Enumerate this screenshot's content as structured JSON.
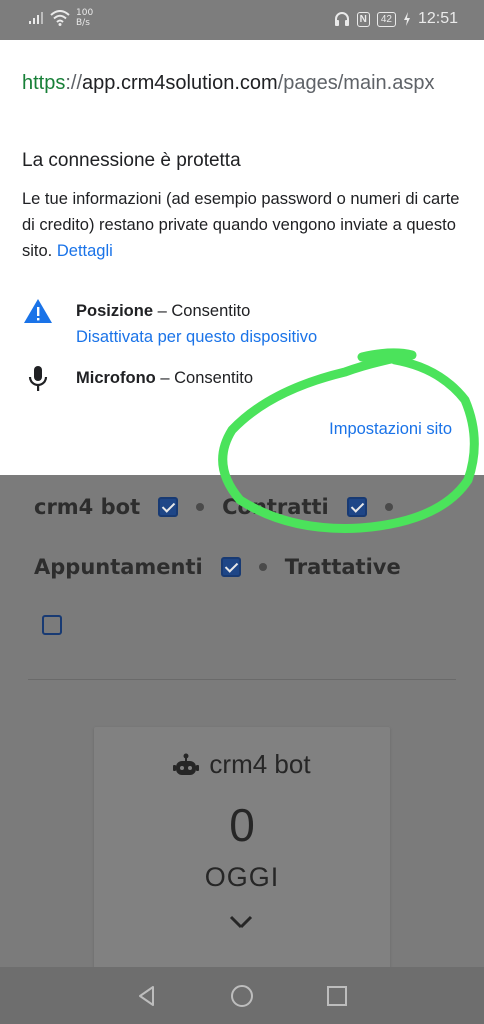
{
  "status_bar": {
    "net_speed_value": "100",
    "net_speed_unit": "B/s",
    "battery": "42",
    "nfc": "N",
    "time": "12:51"
  },
  "popup": {
    "url": {
      "scheme": "https",
      "separator": "://",
      "host": "app.crm4solution.com",
      "path": "/pages/main.aspx"
    },
    "connection_title": "La connessione è protetta",
    "connection_desc": "Le tue informazioni (ad esempio password o numeri di carte di credito) restano private quando vengono inviate a questo sito.",
    "details_link": "Dettagli",
    "permissions": [
      {
        "name": "Posizione",
        "status": "Consentito",
        "sub": "Disattivata per questo dispositivo",
        "icon": "warning-triangle-icon"
      },
      {
        "name": "Microfono",
        "status": "Consentito",
        "icon": "microphone-icon"
      }
    ],
    "dash": "–",
    "site_settings": "Impostazioni sito"
  },
  "page": {
    "filters": [
      {
        "label": "crm4 bot",
        "checked": true
      },
      {
        "label": "Contratti",
        "checked": true
      },
      {
        "label": "Appuntamenti",
        "checked": true
      },
      {
        "label": "Trattative",
        "checked": false
      }
    ],
    "card": {
      "title": "crm4 bot",
      "count": "0",
      "period": "OGGI"
    }
  },
  "colors": {
    "link": "#1a73e8",
    "secure": "#188038",
    "annotation": "#4be35b",
    "checkbox": "#1e4687"
  }
}
